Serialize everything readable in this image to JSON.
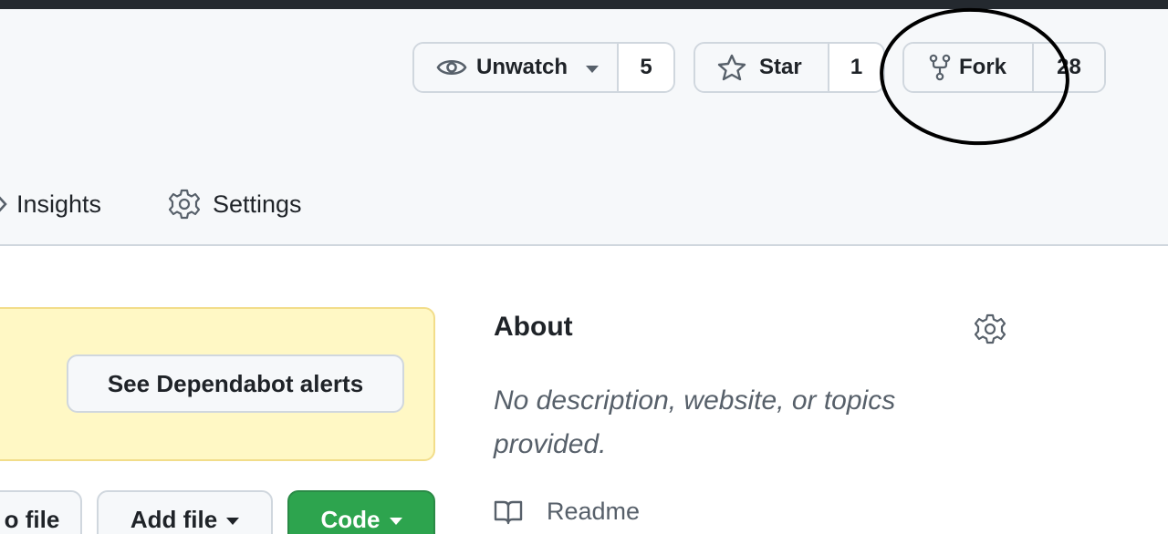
{
  "header": {
    "watch": {
      "label": "Unwatch",
      "count": "5"
    },
    "star": {
      "label": "Star",
      "count": "1"
    },
    "fork": {
      "label": "Fork",
      "count": "28"
    }
  },
  "tabs": [
    {
      "label": "Insights",
      "icon": "graph-icon"
    },
    {
      "label": "Settings",
      "icon": "gear-icon"
    }
  ],
  "alert": {
    "button_label": "See Dependabot alerts"
  },
  "file_actions": {
    "go_to_file_label": "o file",
    "add_file_label": "Add file",
    "code_label": "Code"
  },
  "about": {
    "title": "About",
    "description_line1": "No description, website, or topics",
    "description_line2": "provided.",
    "readme_label": "Readme"
  },
  "colors": {
    "header_bg": "#f6f8fa",
    "alert_bg": "#fff8c5",
    "code_button": "#2da44e",
    "annotation": "#000000"
  },
  "annotation": {
    "shape": "ellipse",
    "target": "fork-button"
  }
}
